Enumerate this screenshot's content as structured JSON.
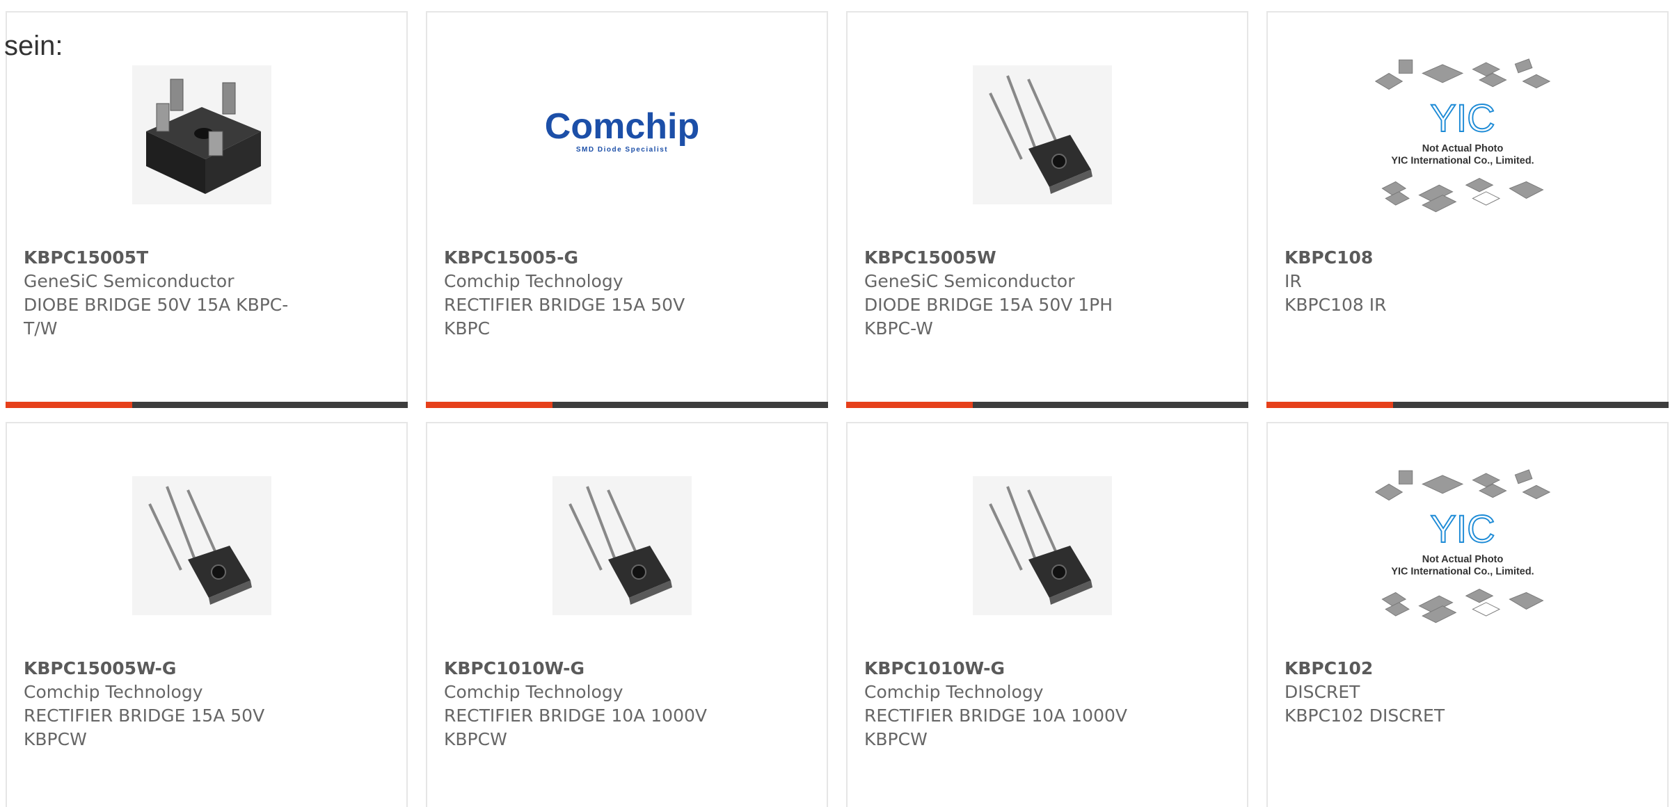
{
  "prefix_text": "sein:",
  "colors": {
    "accent": "#e6401b",
    "bar_dark": "#3d3d3d",
    "comchip_blue": "#1c4fa8"
  },
  "products": [
    {
      "part": "KBPC15005T",
      "manufacturer": "GeneSiC Semiconductor",
      "description": "DIOBE BRIDGE 50V 15A KBPC-T/W",
      "image": "square-bridge-black"
    },
    {
      "part": "KBPC15005-G",
      "manufacturer": "Comchip Technology",
      "description": "RECTIFIER BRIDGE 15A 50V KBPC",
      "image": "comchip-logo",
      "logo_text": "Comchip",
      "logo_tagline": "SMD Diode Specialist"
    },
    {
      "part": "KBPC15005W",
      "manufacturer": "GeneSiC Semiconductor",
      "description": "DIODE BRIDGE 15A 50V 1PH KBPC-W",
      "image": "bridge-wire-leads"
    },
    {
      "part": "KBPC108",
      "manufacturer": "IR",
      "description": "KBPC108 IR",
      "image": "yic-placeholder",
      "logo_text": "YIC",
      "notice_line1": "Not Actual Photo",
      "notice_line2": "YIC International Co., Limited."
    },
    {
      "part": "KBPC15005W-G",
      "manufacturer": "Comchip Technology",
      "description": "RECTIFIER BRIDGE 15A 50V KBPCW",
      "image": "bridge-wire-leads"
    },
    {
      "part": "KBPC1010W-G",
      "manufacturer": "Comchip Technology",
      "description": "RECTIFIER BRIDGE 10A 1000V KBPCW",
      "image": "bridge-wire-leads"
    },
    {
      "part": "KBPC1010W-G",
      "manufacturer": "Comchip Technology",
      "description": "RECTIFIER BRIDGE 10A 1000V KBPCW",
      "image": "bridge-wire-leads"
    },
    {
      "part": "KBPC102",
      "manufacturer": "DISCRET",
      "description": "KBPC102 DISCRET",
      "image": "yic-placeholder",
      "logo_text": "YIC",
      "notice_line1": "Not Actual Photo",
      "notice_line2": "YIC International Co., Limited."
    }
  ]
}
